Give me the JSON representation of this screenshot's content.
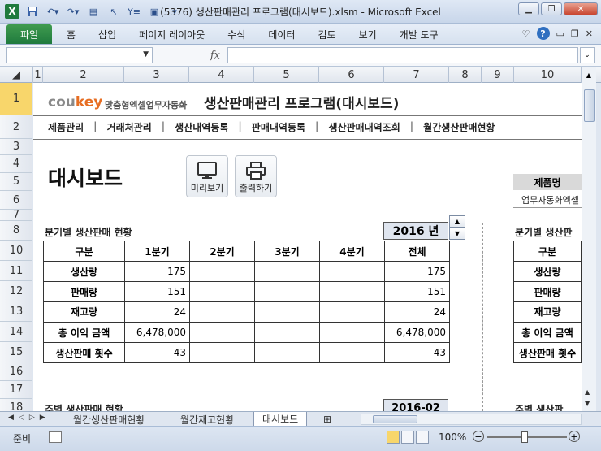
{
  "window": {
    "title": "(5376) 생산판매관리 프로그램(대시보드).xlsm  -  Microsoft Excel"
  },
  "ribbon": {
    "file_tab": "파일",
    "tabs": [
      "홈",
      "삽입",
      "페이지 레이아웃",
      "수식",
      "데이터",
      "검토",
      "보기",
      "개발 도구"
    ]
  },
  "formula_bar": {
    "fx_label": "fx",
    "name_box": "",
    "formula": ""
  },
  "columns": [
    "1",
    "2",
    "3",
    "4",
    "5",
    "6",
    "7",
    "8",
    "9",
    "10"
  ],
  "rows": [
    "1",
    "2",
    "3",
    "4",
    "5",
    "6",
    "7",
    "8",
    "10",
    "11",
    "12",
    "13",
    "14",
    "15",
    "16",
    "17",
    "18"
  ],
  "sheet": {
    "logo_main": "cou",
    "logo_accent": "key",
    "logo_sub": "맞춤형엑셀업무자동화",
    "app_title": "생산판매관리 프로그램(대시보드)",
    "menu": [
      "제품관리",
      "거래처관리",
      "생산내역등록",
      "판매내역등록",
      "생산판매내역조회",
      "월간생산판매현황"
    ],
    "dashboard_title": "대시보드",
    "preview_button": "미리보기",
    "print_button": "출력하기",
    "product_name_header": "제품명",
    "product_name_value": "업무자동화엑셀",
    "quarterly_title": "분기별 생산판매 현황",
    "year_value": "2016 년",
    "quarter_headers": [
      "구분",
      "1분기",
      "2분기",
      "3분기",
      "4분기",
      "전체"
    ],
    "quarter_rows": [
      {
        "label": "생산량",
        "q1": "175",
        "q2": "",
        "q3": "",
        "q4": "",
        "total": "175"
      },
      {
        "label": "판매량",
        "q1": "151",
        "q2": "",
        "q3": "",
        "q4": "",
        "total": "151"
      },
      {
        "label": "재고량",
        "q1": "24",
        "q2": "",
        "q3": "",
        "q4": "",
        "total": "24"
      },
      {
        "label": "총 이익 금액",
        "q1": "6,478,000",
        "q2": "",
        "q3": "",
        "q4": "",
        "total": "6,478,000"
      },
      {
        "label": "생산판매 횟수",
        "q1": "43",
        "q2": "",
        "q3": "",
        "q4": "",
        "total": "43"
      }
    ],
    "right_title": "분기별 생산판",
    "right_rows": [
      "구분",
      "생산량",
      "판매량",
      "재고량",
      "총 이익 금액",
      "생산판매 횟수"
    ],
    "weekly_title": "주별 생산판매 현황",
    "week_value": "2016-02",
    "right_weekly_title": "주별 생산판"
  },
  "sheet_tabs": [
    "월간생산판매현황",
    "월간재고현황",
    "대시보드"
  ],
  "status": {
    "ready": "준비",
    "zoom": "100%"
  }
}
